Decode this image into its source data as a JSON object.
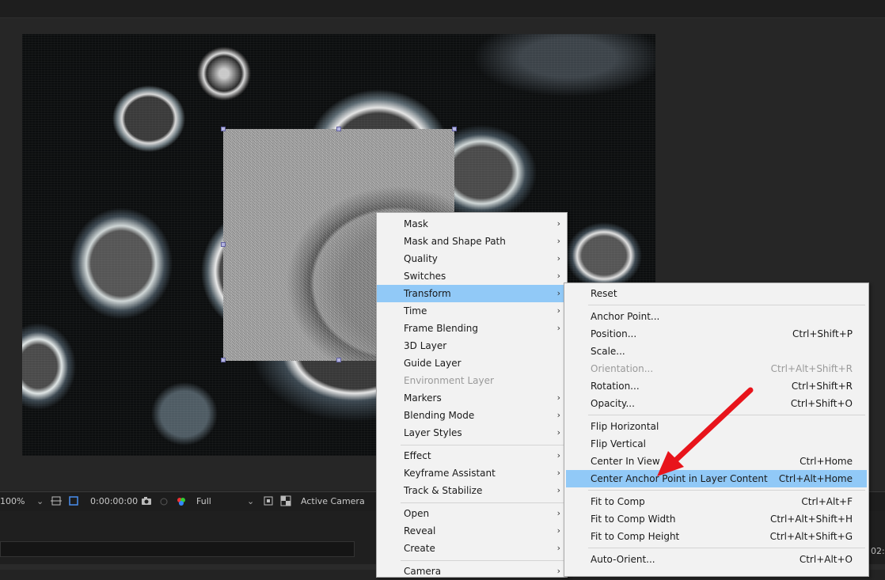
{
  "viewer_toolbar": {
    "zoom": "100%",
    "timecode": "0:00:00:00",
    "resolution": "Full",
    "camera": "Active Camera"
  },
  "timeline": {
    "time_fragment": "02:"
  },
  "context_menu": {
    "items": [
      {
        "label": "Mask",
        "submenu": true
      },
      {
        "label": "Mask and Shape Path",
        "submenu": true
      },
      {
        "label": "Quality",
        "submenu": true
      },
      {
        "label": "Switches",
        "submenu": true
      },
      {
        "label": "Transform",
        "submenu": true
      },
      {
        "label": "Time",
        "submenu": true
      },
      {
        "label": "Frame Blending",
        "submenu": true
      },
      {
        "label": "3D Layer",
        "submenu": false
      },
      {
        "label": "Guide Layer",
        "submenu": false
      },
      {
        "label": "Environment Layer",
        "submenu": false
      },
      {
        "label": "Markers",
        "submenu": true
      },
      {
        "label": "Blending Mode",
        "submenu": true
      },
      {
        "label": "Layer Styles",
        "submenu": true
      },
      {
        "label": "Effect",
        "submenu": true
      },
      {
        "label": "Keyframe Assistant",
        "submenu": true
      },
      {
        "label": "Track & Stabilize",
        "submenu": true
      },
      {
        "label": "Open",
        "submenu": true
      },
      {
        "label": "Reveal",
        "submenu": true
      },
      {
        "label": "Create",
        "submenu": true
      },
      {
        "label": "Camera",
        "submenu": true
      }
    ]
  },
  "transform_submenu": {
    "items": [
      {
        "label": "Reset",
        "shortcut": ""
      },
      {
        "label": "Anchor Point...",
        "shortcut": ""
      },
      {
        "label": "Position...",
        "shortcut": "Ctrl+Shift+P"
      },
      {
        "label": "Scale...",
        "shortcut": ""
      },
      {
        "label": "Orientation...",
        "shortcut": "Ctrl+Alt+Shift+R"
      },
      {
        "label": "Rotation...",
        "shortcut": "Ctrl+Shift+R"
      },
      {
        "label": "Opacity...",
        "shortcut": "Ctrl+Shift+O"
      },
      {
        "label": "Flip Horizontal",
        "shortcut": ""
      },
      {
        "label": "Flip Vertical",
        "shortcut": ""
      },
      {
        "label": "Center In View",
        "shortcut": "Ctrl+Home"
      },
      {
        "label": "Center Anchor Point in Layer Content",
        "shortcut": "Ctrl+Alt+Home"
      },
      {
        "label": "Fit to Comp",
        "shortcut": "Ctrl+Alt+F"
      },
      {
        "label": "Fit to Comp Width",
        "shortcut": "Ctrl+Alt+Shift+H"
      },
      {
        "label": "Fit to Comp Height",
        "shortcut": "Ctrl+Alt+Shift+G"
      },
      {
        "label": "Auto-Orient...",
        "shortcut": "Ctrl+Alt+O"
      }
    ]
  },
  "colors": {
    "menu_highlight": "#91c9f7",
    "annotation_arrow": "#e8141b",
    "selection_handle": "#b4b4e0"
  }
}
